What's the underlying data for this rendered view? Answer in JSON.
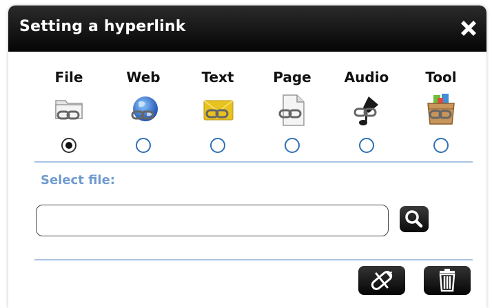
{
  "dialog": {
    "title": "Setting a hyperlink",
    "close_icon": "close-x-icon"
  },
  "link_types": [
    {
      "label": "File",
      "icon": "file-link-icon",
      "selected": true
    },
    {
      "label": "Web",
      "icon": "web-globe-link-icon",
      "selected": false
    },
    {
      "label": "Text",
      "icon": "text-envelope-link-icon",
      "selected": false
    },
    {
      "label": "Page",
      "icon": "page-link-icon",
      "selected": false
    },
    {
      "label": "Audio",
      "icon": "audio-note-link-icon",
      "selected": false
    },
    {
      "label": "Tool",
      "icon": "tool-box-link-icon",
      "selected": false
    }
  ],
  "file_section": {
    "label": "Select file:",
    "input_value": "",
    "search_icon": "search-icon"
  },
  "actions": {
    "edit_icon": "edit-link-icon",
    "delete_icon": "trash-icon"
  },
  "colors": {
    "title_bar": "#0a0a0a",
    "accent_blue": "#6f9bd0",
    "separator": "#a7c3e3",
    "radio_border": "#2f70b5"
  }
}
